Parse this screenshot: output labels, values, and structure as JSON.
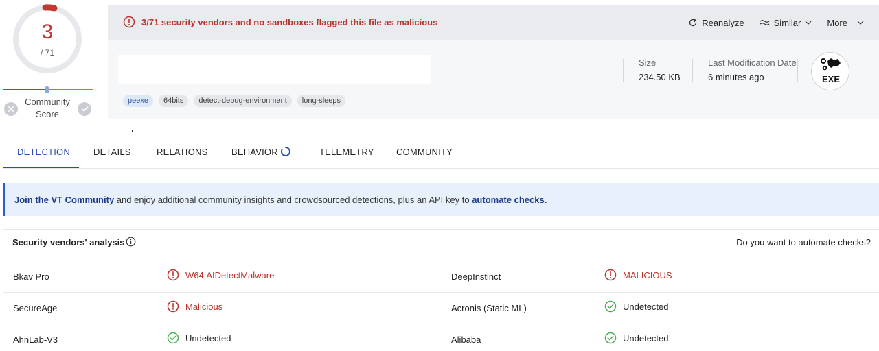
{
  "score": {
    "value": "3",
    "total": "/ 71",
    "label": "Community Score",
    "colors": {
      "malicious": "#c13a32",
      "harmless": "#52a85a"
    }
  },
  "alert": {
    "text": "3/71 security vendors and no sandboxes flagged this file as malicious"
  },
  "actions": {
    "reanalyze": "Reanalyze",
    "similar": "Similar",
    "more": "More"
  },
  "file": {
    "tags": [
      "peexe",
      "64bits",
      "detect-debug-environment",
      "long-sleeps"
    ],
    "size_label": "Size",
    "size_value": "234.50 KB",
    "mod_label": "Last Modification Date",
    "mod_value": "6 minutes ago",
    "type": "EXE"
  },
  "tabs": [
    {
      "label": "DETECTION",
      "active": true
    },
    {
      "label": "DETAILS"
    },
    {
      "label": "RELATIONS"
    },
    {
      "label": "BEHAVIOR"
    },
    {
      "label": "TELEMETRY"
    },
    {
      "label": "COMMUNITY"
    }
  ],
  "banner": {
    "link1": "Join the VT Community",
    "text": " and enjoy additional community insights and crowdsourced detections, plus an API key to ",
    "link2": "automate checks."
  },
  "vendors": {
    "title": "Security vendors' analysis",
    "automate": "Do you want to automate checks?",
    "rows": [
      {
        "left_name": "Bkav Pro",
        "left_result": "W64.AIDetectMalware",
        "left_status": "malicious",
        "right_name": "DeepInstinct",
        "right_result": "MALICIOUS",
        "right_status": "malicious"
      },
      {
        "left_name": "SecureAge",
        "left_result": "Malicious",
        "left_status": "malicious",
        "right_name": "Acronis (Static ML)",
        "right_result": "Undetected",
        "right_status": "undetected"
      },
      {
        "left_name": "AhnLab-V3",
        "left_result": "Undetected",
        "left_status": "undetected",
        "right_name": "Alibaba",
        "right_result": "Undetected",
        "right_status": "undetected"
      }
    ]
  }
}
